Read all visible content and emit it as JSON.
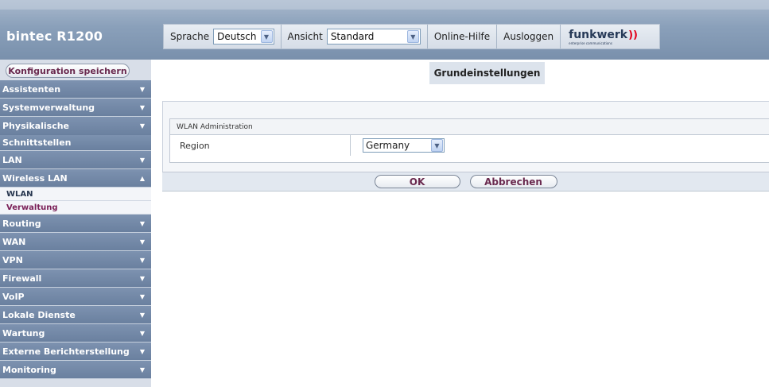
{
  "header": {
    "brand": "bintec R1200",
    "language_label": "Sprache",
    "language_value": "Deutsch",
    "view_label": "Ansicht",
    "view_value": "Standard",
    "help_link": "Online-Hilfe",
    "logout_link": "Ausloggen",
    "logo_text": "funkwerk",
    "logo_sub": "enterprise communications"
  },
  "sidebar": {
    "save_button": "Konfiguration speichern",
    "items": [
      {
        "label": "Assistenten"
      },
      {
        "label": "Systemverwaltung"
      },
      {
        "label": "Physikalische"
      },
      {
        "label": "Schnittstellen"
      },
      {
        "label": "LAN"
      },
      {
        "label": "Wireless LAN"
      },
      {
        "label": "WLAN"
      },
      {
        "label": "Verwaltung"
      },
      {
        "label": "Routing"
      },
      {
        "label": "WAN"
      },
      {
        "label": "VPN"
      },
      {
        "label": "Firewall"
      },
      {
        "label": "VoIP"
      },
      {
        "label": "Lokale Dienste"
      },
      {
        "label": "Wartung"
      },
      {
        "label": "Externe Berichterstellung"
      },
      {
        "label": "Monitoring"
      }
    ]
  },
  "main": {
    "title": "Grundeinstellungen",
    "section_title": "WLAN Administration",
    "region_label": "Region",
    "region_value": "Germany",
    "ok_button": "OK",
    "cancel_button": "Abbrechen"
  }
}
